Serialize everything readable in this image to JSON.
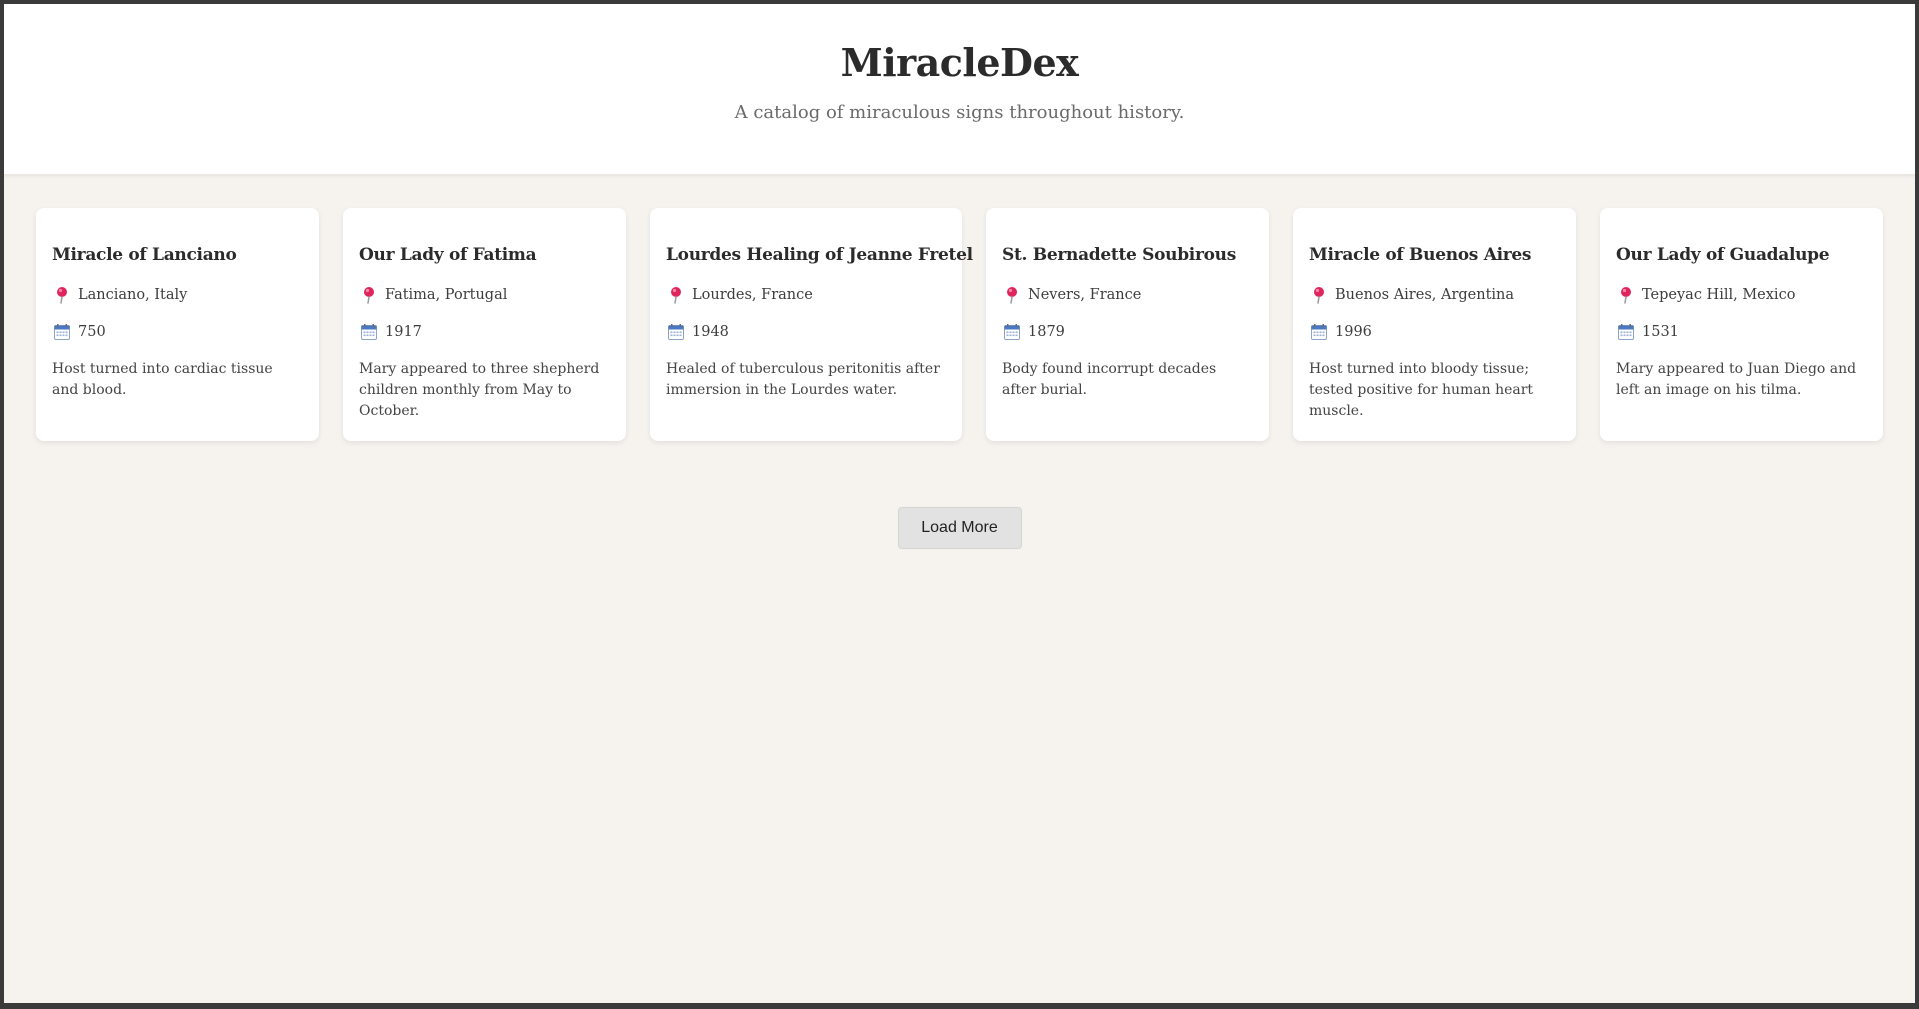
{
  "header": {
    "title": "MiracleDex",
    "subtitle": "A catalog of miraculous signs throughout history."
  },
  "icons": {
    "location": "pin-icon",
    "year": "calendar-icon"
  },
  "colors": {
    "pin": "#e0245e",
    "calendar": "#4a78c2",
    "background": "#f6f3ef",
    "button": "#e2e2e2"
  },
  "miracles": [
    {
      "title": "Miracle of Lanciano",
      "location": "Lanciano, Italy",
      "year": "750",
      "description": "Host turned into cardiac tissue and blood."
    },
    {
      "title": "Our Lady of Fatima",
      "location": "Fatima, Portugal",
      "year": "1917",
      "description": "Mary appeared to three shepherd children monthly from May to October."
    },
    {
      "title": "Lourdes Healing of Jeanne Fretel",
      "location": "Lourdes, France",
      "year": "1948",
      "description": "Healed of tuberculous peritonitis after immersion in the Lourdes water."
    },
    {
      "title": "St. Bernadette Soubirous",
      "location": "Nevers, France",
      "year": "1879",
      "description": "Body found incorrupt decades after burial."
    },
    {
      "title": "Miracle of Buenos Aires",
      "location": "Buenos Aires, Argentina",
      "year": "1996",
      "description": "Host turned into bloody tissue; tested positive for human heart muscle."
    },
    {
      "title": "Our Lady of Guadalupe",
      "location": "Tepeyac Hill, Mexico",
      "year": "1531",
      "description": "Mary appeared to Juan Diego and left an image on his tilma."
    }
  ],
  "actions": {
    "load_more_label": "Load More"
  }
}
